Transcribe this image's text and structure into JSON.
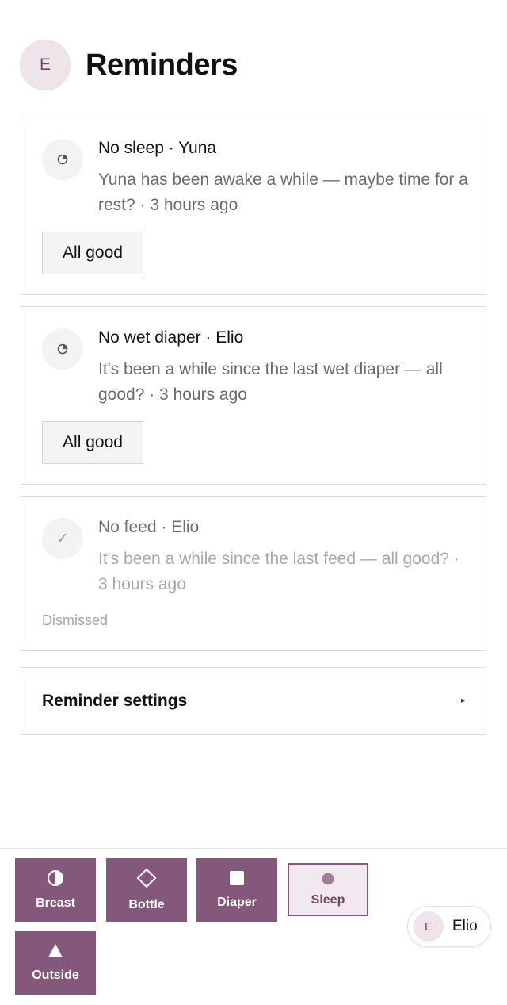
{
  "header": {
    "avatar_initial": "E",
    "title": "Reminders"
  },
  "reminders": [
    {
      "title": "No sleep · Yuna",
      "body": "Yuna has been awake a while — maybe time for a rest? · 3 hours ago",
      "icon": "clock-icon",
      "action_label": "All good"
    },
    {
      "title": "No wet diaper · Elio",
      "body": "It's been a while since the last wet diaper — all good? · 3 hours ago",
      "icon": "clock-icon",
      "action_label": "All good"
    },
    {
      "title": "No feed · Elio",
      "body": "It's been a while since the last feed — all good? · 3 hours ago",
      "icon": "check-icon",
      "status": "Dismissed"
    }
  ],
  "settings": {
    "label": "Reminder settings"
  },
  "quick_actions": [
    {
      "label": "Breast",
      "icon": "half-circle-icon"
    },
    {
      "label": "Bottle",
      "icon": "diamond-icon"
    },
    {
      "label": "Diaper",
      "icon": "square-icon"
    },
    {
      "label": "Sleep",
      "icon": "dot-icon"
    },
    {
      "label": "Outside",
      "icon": "triangle-icon"
    }
  ],
  "child_switcher": {
    "avatar_initial": "E",
    "name": "Elio"
  },
  "colors": {
    "accent": "#84587a",
    "accent_light": "#f2e8ef",
    "muted_text": "#6b6b6b",
    "dismissed_text": "#a8a8a8"
  }
}
